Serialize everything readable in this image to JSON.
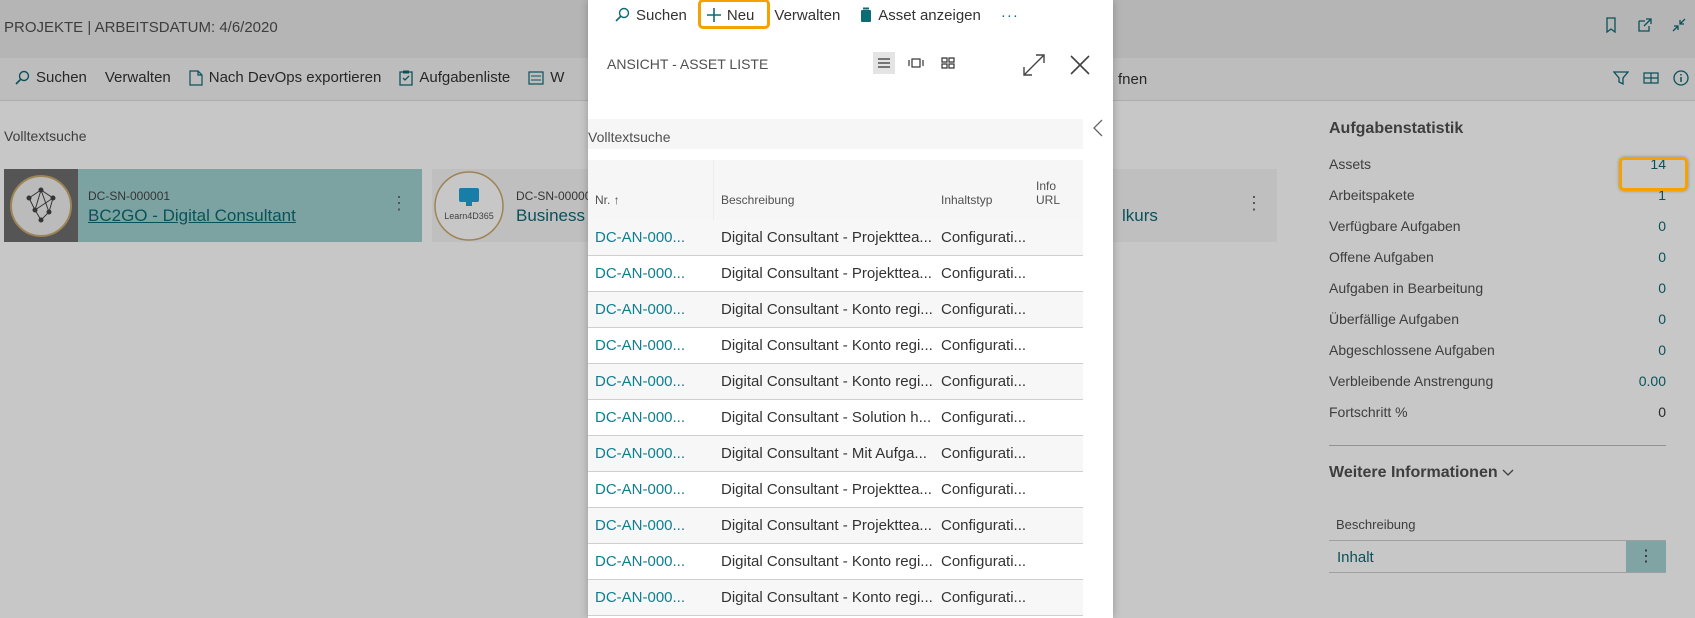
{
  "page": {
    "title": "PROJEKTE | ARBEITSDATUM: 4/6/2020",
    "actions": [
      {
        "label": "Suchen",
        "icon": "search-icon"
      },
      {
        "label": "Verwalten",
        "icon": ""
      },
      {
        "label": "Nach DevOps exportieren",
        "icon": "document-icon"
      },
      {
        "label": "Aufgabenliste",
        "icon": "clipboard-check-icon"
      },
      {
        "label": "W",
        "icon": "list-icon"
      }
    ],
    "action_tail": "fnen",
    "volltextsuche": "Volltextsuche",
    "tiles": [
      {
        "code": "DC-SN-000001",
        "name": "BC2GO - Digital Consultant",
        "logo_text": ""
      },
      {
        "code": "DC-SN-00000",
        "name": "Business C",
        "logo_text": "Learn4D365",
        "tail": "lkurs"
      }
    ]
  },
  "stats": {
    "title": "Aufgabenstatistik",
    "rows": [
      {
        "label": "Assets",
        "value": "14"
      },
      {
        "label": "Arbeitspakete",
        "value": "1"
      },
      {
        "label": "Verfügbare Aufgaben",
        "value": "0"
      },
      {
        "label": "Offene Aufgaben",
        "value": "0"
      },
      {
        "label": "Aufgaben in Bearbeitung",
        "value": "0"
      },
      {
        "label": "Überfällige Aufgaben",
        "value": "0"
      },
      {
        "label": "Abgeschlossene Aufgaben",
        "value": "0"
      },
      {
        "label": "Verbleibende Anstrengung",
        "value": "0.00"
      },
      {
        "label": "Fortschritt %",
        "value": "0"
      }
    ],
    "more_title": "Weitere Informationen",
    "beschreibung_label": "Beschreibung",
    "inhalt": "Inhalt"
  },
  "dialog": {
    "actions": {
      "suchen": "Suchen",
      "neu": "Neu",
      "verwalten": "Verwalten",
      "asset_anzeigen": "Asset anzeigen",
      "more": "···"
    },
    "title": "ANSICHT - ASSET LISTE",
    "volltextsuche": "Volltextsuche",
    "columns": {
      "nr": "Nr. ↑",
      "beschreibung": "Beschreibung",
      "inhaltstyp": "Inhaltstyp",
      "info_url": "Info URL"
    },
    "rows": [
      {
        "nr": "DC-AN-000...",
        "desc": "Digital Consultant - Projekttea...",
        "typ": "Configurati..."
      },
      {
        "nr": "DC-AN-000...",
        "desc": "Digital Consultant - Projekttea...",
        "typ": "Configurati..."
      },
      {
        "nr": "DC-AN-000...",
        "desc": "Digital Consultant - Konto regi...",
        "typ": "Configurati..."
      },
      {
        "nr": "DC-AN-000...",
        "desc": "Digital Consultant - Konto regi...",
        "typ": "Configurati..."
      },
      {
        "nr": "DC-AN-000...",
        "desc": "Digital Consultant - Konto regi...",
        "typ": "Configurati..."
      },
      {
        "nr": "DC-AN-000...",
        "desc": "Digital Consultant - Solution h...",
        "typ": "Configurati..."
      },
      {
        "nr": "DC-AN-000...",
        "desc": "Digital Consultant - Mit Aufga...",
        "typ": "Configurati..."
      },
      {
        "nr": "DC-AN-000...",
        "desc": "Digital Consultant - Projekttea...",
        "typ": "Configurati..."
      },
      {
        "nr": "DC-AN-000...",
        "desc": "Digital Consultant - Projekttea...",
        "typ": "Configurati..."
      },
      {
        "nr": "DC-AN-000...",
        "desc": "Digital Consultant - Konto regi...",
        "typ": "Configurati..."
      },
      {
        "nr": "DC-AN-000...",
        "desc": "Digital Consultant - Konto regi...",
        "typ": "Configurati..."
      }
    ]
  },
  "colors": {
    "accent": "#0e6a75",
    "highlight": "#f5a100",
    "tile_selected": "#9fd1d0"
  }
}
